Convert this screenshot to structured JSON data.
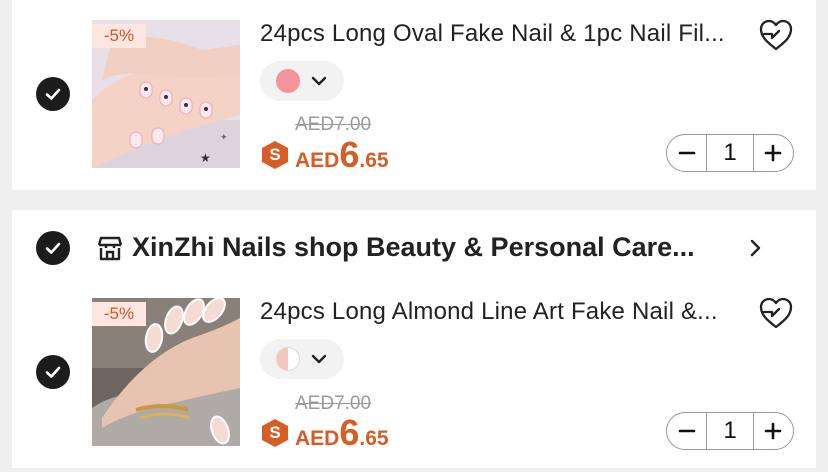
{
  "colors": {
    "accent": "#d75d27",
    "discount_tag_bg": "#fde7e0",
    "check_bg": "#1c1c1c",
    "page_bg": "#efefef"
  },
  "icons": {
    "selected": "checkmark-circle-icon",
    "wishlist": "heart-plus-icon",
    "variant_dropdown": "chevron-down-icon",
    "store": "store-icon",
    "store_link": "chevron-right-icon",
    "qty_minus": "minus-icon",
    "qty_plus": "plus-icon",
    "sale_badge": "s-badge-icon"
  },
  "items": [
    {
      "selected": true,
      "discount_tag": "-5%",
      "title": "24pcs Long Oval Fake Nail & 1pc Nail Fil...",
      "variant_color": "#f6929c",
      "old_price": "AED7.00",
      "sale_badge": "S",
      "price_currency": "AED",
      "price_int": "6",
      "price_dec": ".65",
      "minus": "−",
      "qty": "1",
      "plus": "+"
    },
    {
      "selected": true,
      "discount_tag": "-5%",
      "title": "24pcs Long Almond Line Art Fake Nail &...",
      "variant_color": "#f3c6bf",
      "old_price": "AED7.00",
      "sale_badge": "S",
      "price_currency": "AED",
      "price_int": "6",
      "price_dec": ".65",
      "minus": "−",
      "qty": "1",
      "plus": "+"
    }
  ],
  "store": {
    "selected": true,
    "name": "XinZhi Nails shop Beauty & Personal Care..."
  }
}
